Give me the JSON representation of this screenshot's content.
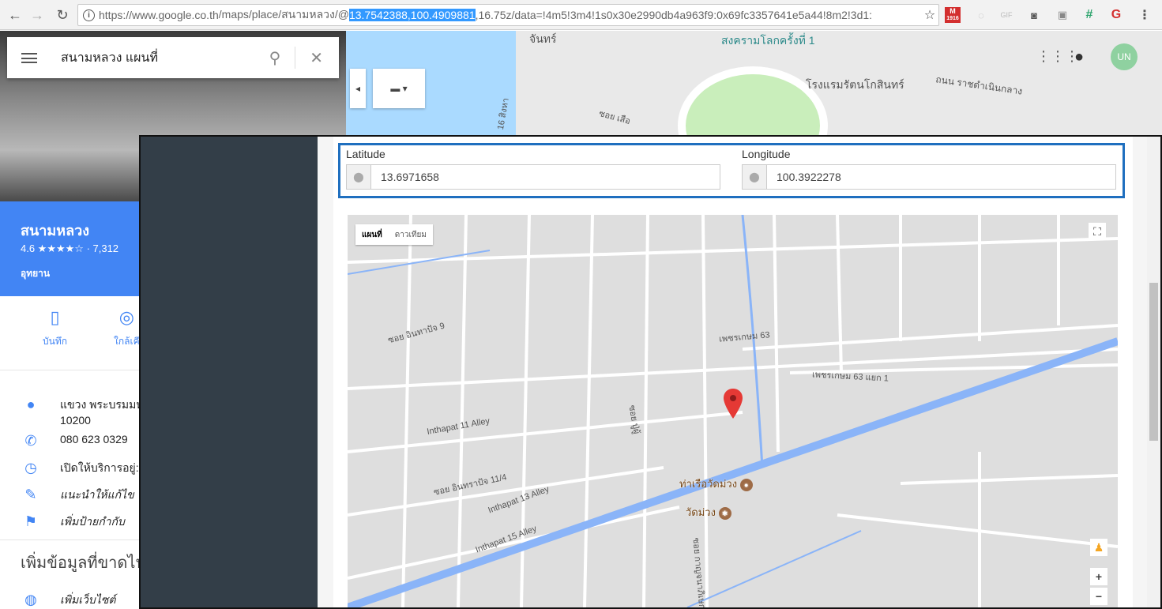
{
  "browser": {
    "url_prefix": "https://www.google.co.th",
    "url_path": "/maps/place/สนามหลวง/@",
    "url_selected": "13.7542388,100.4909881",
    "url_suffix": ",16.75z/data=!4m5!3m4!1s0x30e2990db4a963f9:0x69fc3357641e5a44!8m2!3d1:",
    "ext_badge": "1916"
  },
  "search": {
    "query": "สนามหลวง แผนที่"
  },
  "bg_map": {
    "labels": [
      "จันทร์",
      "สงครามโลกครั้งที่ 1",
      "โรงแรมรัตนโกสินทร์",
      "ถนน ราชดำเนินกลาง",
      "ซอย เสือ",
      "16 สิงหา"
    ]
  },
  "place": {
    "name": "สนามหลวง",
    "rating": "4.6 ★★★★☆ · 7,312",
    "category": "อุทยาน",
    "actions": [
      "บันทึก",
      "ใกล้เคี"
    ],
    "address_line1": "แขวง พระบรมมห",
    "address_line2": "10200",
    "phone": "080 623 0329",
    "hours": "เปิดให้บริการอยู่:",
    "suggest_edit": "แนะนำให้แก้ไข",
    "add_label": "เพิ่มป้ายกำกับ",
    "missing_info": "เพิ่มข้อมูลที่ขาดไป",
    "add_website": "เพิ่มเว็บไซต์"
  },
  "form": {
    "latitude_label": "Latitude",
    "latitude_value": "13.6971658",
    "longitude_label": "Longitude",
    "longitude_value": "100.3922278"
  },
  "embed_map": {
    "type_map": "แผนที่",
    "type_satellite": "ดาวเทียม",
    "street_labels": [
      "ซอย อินทาปัจ 9",
      "เพชรเกษม 63",
      "เพชรเกษม 63 แยก 1",
      "Inthapat 11 Alley",
      "ซอย อินทราปัจ 11/4",
      "Inthapat 13 Alley",
      "Inthapat 15 Alley",
      "ซอย ปู่ผู้",
      "ซอย กาญจนาภิเษก"
    ],
    "poi_pier": "ท่าเรือวัดม่วง",
    "poi_temple": "วัดม่วง"
  }
}
